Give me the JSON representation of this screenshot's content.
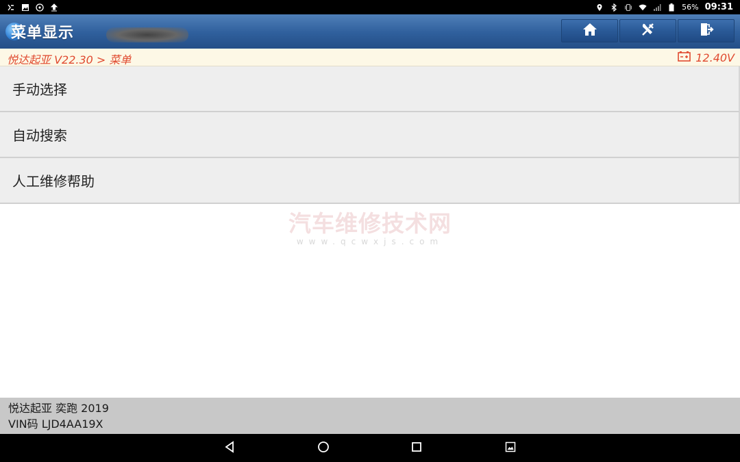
{
  "status_bar": {
    "battery_percent": "56%",
    "time": "09:31"
  },
  "title_bar": {
    "title": "菜单显示",
    "buttons": [
      {
        "name": "home",
        "icon": "home-icon"
      },
      {
        "name": "diagnose",
        "icon": "tools-icon"
      },
      {
        "name": "exit",
        "icon": "exit-door-icon"
      }
    ]
  },
  "breadcrumb": {
    "path": "悦达起亚 V22.30 > 菜单",
    "voltage": "12.40V",
    "voltage_icon": "battery-icon",
    "accent_color": "#e0492f"
  },
  "menu": {
    "items": [
      {
        "label": "手动选择"
      },
      {
        "label": "自动搜索"
      },
      {
        "label": "人工维修帮助"
      }
    ]
  },
  "watermark": {
    "title": "汽车维修技术网",
    "url": "www.qcwxjs.com"
  },
  "vehicle_info": {
    "model": "悦达起亚 奕跑 2019",
    "vin": "VIN码 LJD4AA19X"
  },
  "colors": {
    "title_bar_blue": "#2f5f9c",
    "menu_bg": "#eeeeee",
    "info_bar_bg": "#c8c8c8"
  }
}
